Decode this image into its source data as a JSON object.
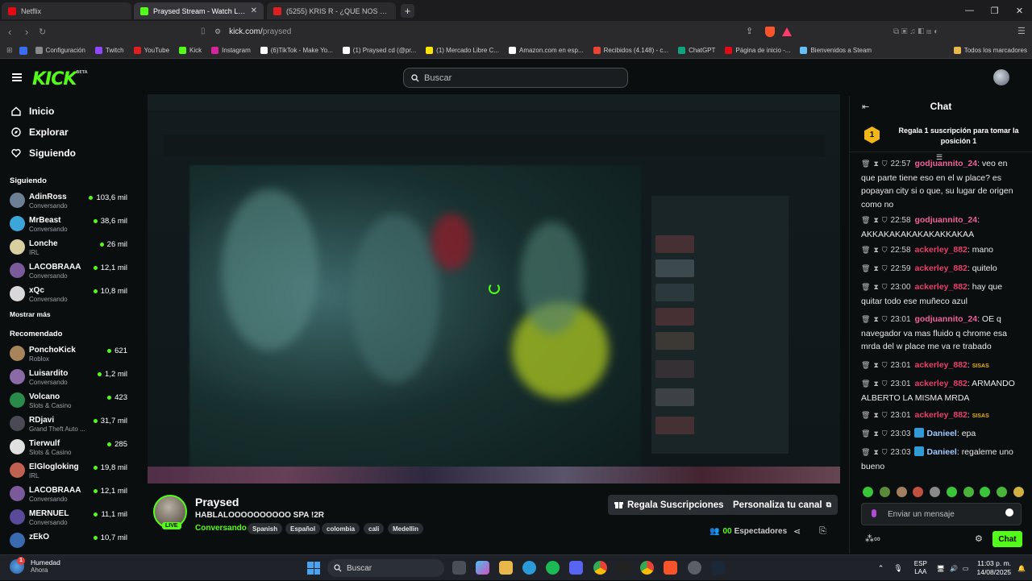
{
  "browser": {
    "tabs": [
      {
        "title": "Netflix",
        "color": "#e50914"
      },
      {
        "title": "Praysed Stream - Watch Live on Kick",
        "color": "#53fc18"
      },
      {
        "title": "(5255) KRIS R - ¿QUE NOS PASÓ?",
        "color": "#e02020"
      }
    ],
    "url_host": "kick.com/",
    "url_path": "praysed",
    "bookmarks": [
      {
        "label": "Configuración",
        "color": "#8a8a8a"
      },
      {
        "label": "Twitch",
        "color": "#9146ff"
      },
      {
        "label": "YouTube",
        "color": "#e02020"
      },
      {
        "label": "Kick",
        "color": "#53fc18"
      },
      {
        "label": "Instagram",
        "color": "#d6249f"
      },
      {
        "label": "(6)TikTok - Make Yo...",
        "color": "#ffffff"
      },
      {
        "label": "(1) Praysed cd (@pr...",
        "color": "#ffffff"
      },
      {
        "label": "(1) Mercado Libre C...",
        "color": "#ffe600"
      },
      {
        "label": "Amazon.com en esp...",
        "color": "#ffffff"
      },
      {
        "label": "Recibidos (4.148) - c...",
        "color": "#ea4335"
      },
      {
        "label": "ChatGPT",
        "color": "#10a37f"
      },
      {
        "label": "Página de inicio -...",
        "color": "#e50914"
      },
      {
        "label": "Bienvenidos a Steam",
        "color": "#1b2838"
      }
    ],
    "bookmarks_all": "Todos los marcadores"
  },
  "header": {
    "logo": "KICK",
    "logo_beta": "BETA",
    "search_placeholder": "Buscar"
  },
  "sidebar": {
    "nav": [
      {
        "label": "Inicio",
        "icon": "home-icon"
      },
      {
        "label": "Explorar",
        "icon": "compass-icon"
      },
      {
        "label": "Siguiendo",
        "icon": "heart-icon"
      }
    ],
    "following_title": "Siguiendo",
    "following": [
      {
        "name": "AdinRoss",
        "sub": "Conversando",
        "viewers": "103,6 mil",
        "color": "#6c7f95"
      },
      {
        "name": "MrBeast",
        "sub": "Conversando",
        "viewers": "38,6 mil",
        "color": "#3da6d8"
      },
      {
        "name": "Lonche",
        "sub": "IRL",
        "viewers": "26 mil",
        "color": "#d8cfa0"
      },
      {
        "name": "LACOBRAAA",
        "sub": "Conversando",
        "viewers": "12,1 mil",
        "color": "#7a5a9a"
      },
      {
        "name": "xQc",
        "sub": "Conversando",
        "viewers": "10,8 mil",
        "color": "#d8d8d8"
      }
    ],
    "show_more": "Mostrar más",
    "recommended_title": "Recomendado",
    "recommended": [
      {
        "name": "PonchoKick",
        "sub": "Roblox",
        "viewers": "621",
        "color": "#a8845a"
      },
      {
        "name": "Luisardito",
        "sub": "Conversando",
        "viewers": "1,2 mil",
        "color": "#8b6aa8"
      },
      {
        "name": "Volcano",
        "sub": "Slots & Casino",
        "viewers": "423",
        "color": "#2a8a4a"
      },
      {
        "name": "RDjavi",
        "sub": "Grand Theft Auto ...",
        "viewers": "31,7 mil",
        "color": "#4a4a55"
      },
      {
        "name": "Tierwulf",
        "sub": "Slots & Casino",
        "viewers": "285",
        "color": "#e0e0e0"
      },
      {
        "name": "ElGlogloking",
        "sub": "IRL",
        "viewers": "19,8 mil",
        "color": "#c06050"
      },
      {
        "name": "LACOBRAAA",
        "sub": "Conversando",
        "viewers": "12,1 mil",
        "color": "#7a5a9a"
      },
      {
        "name": "MERNUEL",
        "sub": "Conversando",
        "viewers": "11,1 mil",
        "color": "#5a4a9a"
      },
      {
        "name": "zEkO",
        "sub": "",
        "viewers": "10,7 mil",
        "color": "#3a6ab0"
      }
    ]
  },
  "stream": {
    "name": "Praysed",
    "live": "LIVE",
    "title": "HABLALOOOOOOOOOO SPA !2R",
    "category": "Conversando",
    "tags": [
      "Spanish",
      "Español",
      "colombia",
      "cali",
      "Medellin"
    ],
    "gift_button": "Regala Suscripciones",
    "customize_button": "Personaliza tu canal",
    "viewers_count": "00",
    "viewers_label": "Espectadores"
  },
  "chat": {
    "title": "Chat",
    "gift_rank": "1",
    "gift_text": "Regala 1 suscripción para tomar la posición 1",
    "messages": [
      {
        "time": "22:57",
        "user": "godjuannito_24",
        "user_color": "#f0609a",
        "text": "veo en que parte tiene eso en el w place? es popayan city si o que, su lugar de origen como no",
        "verified": false,
        "emote": false
      },
      {
        "time": "22:58",
        "user": "godjuannito_24",
        "user_color": "#f0609a",
        "text": "AKKAKAKAKAKAKAKKAKAA",
        "verified": false,
        "emote": false
      },
      {
        "time": "22:58",
        "user": "ackerley_882",
        "user_color": "#e8406a",
        "text": "mano",
        "verified": false,
        "emote": false
      },
      {
        "time": "22:59",
        "user": "ackerley_882",
        "user_color": "#e8406a",
        "text": "quitelo",
        "verified": false,
        "emote": false
      },
      {
        "time": "23:00",
        "user": "ackerley_882",
        "user_color": "#e8406a",
        "text": "hay que quitar todo ese muñeco azul",
        "verified": false,
        "emote": false
      },
      {
        "time": "23:01",
        "user": "godjuannito_24",
        "user_color": "#f0609a",
        "text": "OE q navegador va mas fluido q chrome esa mrda del w place me va re trabado",
        "verified": false,
        "emote": false
      },
      {
        "time": "23:01",
        "user": "ackerley_882",
        "user_color": "#e8406a",
        "text": "SISAS",
        "verified": false,
        "emote": true
      },
      {
        "time": "23:01",
        "user": "ackerley_882",
        "user_color": "#e8406a",
        "text": "ARMANDO ALBERTO LA MISMA MRDA",
        "verified": false,
        "emote": false
      },
      {
        "time": "23:01",
        "user": "ackerley_882",
        "user_color": "#e8406a",
        "text": "SISAS",
        "verified": false,
        "emote": true
      },
      {
        "time": "23:03",
        "user": "Danieel",
        "user_color": "#9fc8ff",
        "text": "epa",
        "verified": true,
        "emote": false
      },
      {
        "time": "23:03",
        "user": "Danieel",
        "user_color": "#9fc8ff",
        "text": "regaleme uno bueno",
        "verified": true,
        "emote": false
      }
    ],
    "input_placeholder": "Enviar un mensaje",
    "send_button": "Chat"
  },
  "taskbar": {
    "weather_label": "Humedad",
    "weather_sub": "Ahora",
    "weather_badge": "1",
    "search": "Buscar",
    "lang": "ESP",
    "lang_sub": "LAA",
    "time": "11:03 p. m.",
    "date": "14/08/2025"
  }
}
